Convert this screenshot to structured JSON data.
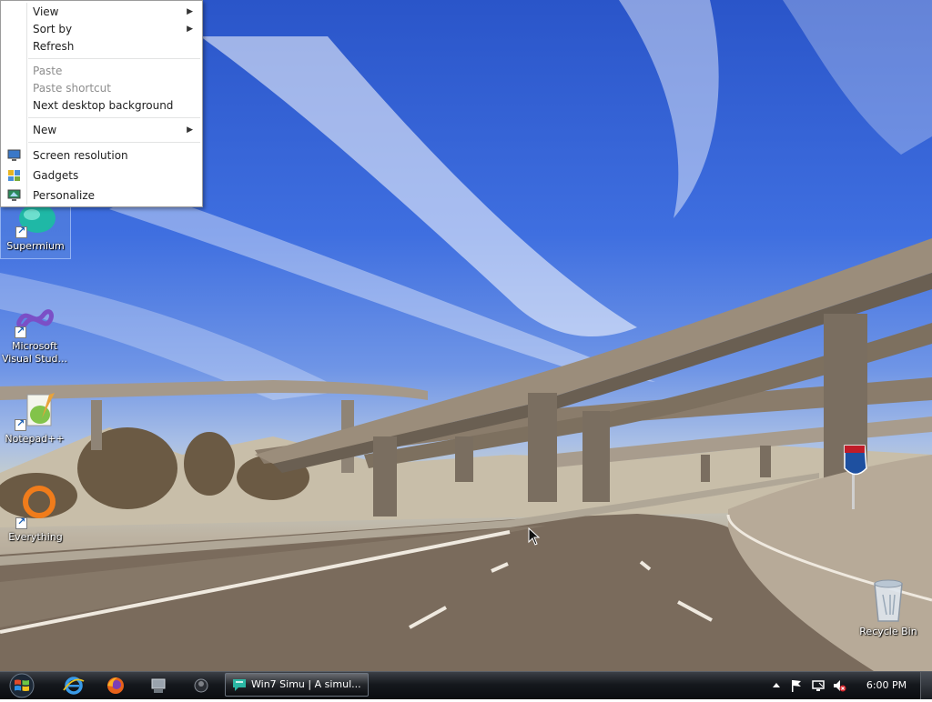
{
  "context_menu": {
    "items": [
      {
        "label": "View",
        "has_submenu": true,
        "enabled": true
      },
      {
        "label": "Sort by",
        "has_submenu": true,
        "enabled": true
      },
      {
        "label": "Refresh",
        "has_submenu": false,
        "enabled": true
      },
      {
        "label": "Paste",
        "has_submenu": false,
        "enabled": false
      },
      {
        "label": "Paste shortcut",
        "has_submenu": false,
        "enabled": false
      },
      {
        "label": "Next desktop background",
        "has_submenu": false,
        "enabled": true
      },
      {
        "label": "New",
        "has_submenu": true,
        "enabled": true
      },
      {
        "label": "Screen resolution",
        "icon": "monitor-icon",
        "enabled": true
      },
      {
        "label": "Gadgets",
        "icon": "gadgets-icon",
        "enabled": true
      },
      {
        "label": "Personalize",
        "icon": "personalize-icon",
        "enabled": true
      }
    ]
  },
  "desktop_icons": [
    {
      "label": "Supermium",
      "icon": "supermium-icon",
      "shortcut": true
    },
    {
      "label": "Microsoft Visual Stud...",
      "icon": "visual-studio-icon",
      "shortcut": true
    },
    {
      "label": "Notepad++",
      "icon": "notepadpp-icon",
      "shortcut": true
    },
    {
      "label": "Everything",
      "icon": "everything-icon",
      "shortcut": true
    },
    {
      "label": "Recycle Bin",
      "icon": "recycle-bin-icon",
      "shortcut": false
    }
  ],
  "taskbar": {
    "start_icon": "windows-logo-icon",
    "pinned": [
      "internet-explorer-icon",
      "firefox-icon",
      "computer-icon",
      "media-icon"
    ],
    "task": {
      "label": "Win7 Simu | A simul...",
      "icon": "win7simu-icon"
    },
    "tray": [
      "show-hidden-icons-icon",
      "action-center-flag-icon",
      "network-icon",
      "volume-muted-icon"
    ],
    "clock": "6:00 PM"
  },
  "colors": {
    "sky": "#3f6fe0",
    "taskbar": "#15181d",
    "menu_bg": "#ffffff",
    "disabled_text": "#8d8d8d"
  }
}
